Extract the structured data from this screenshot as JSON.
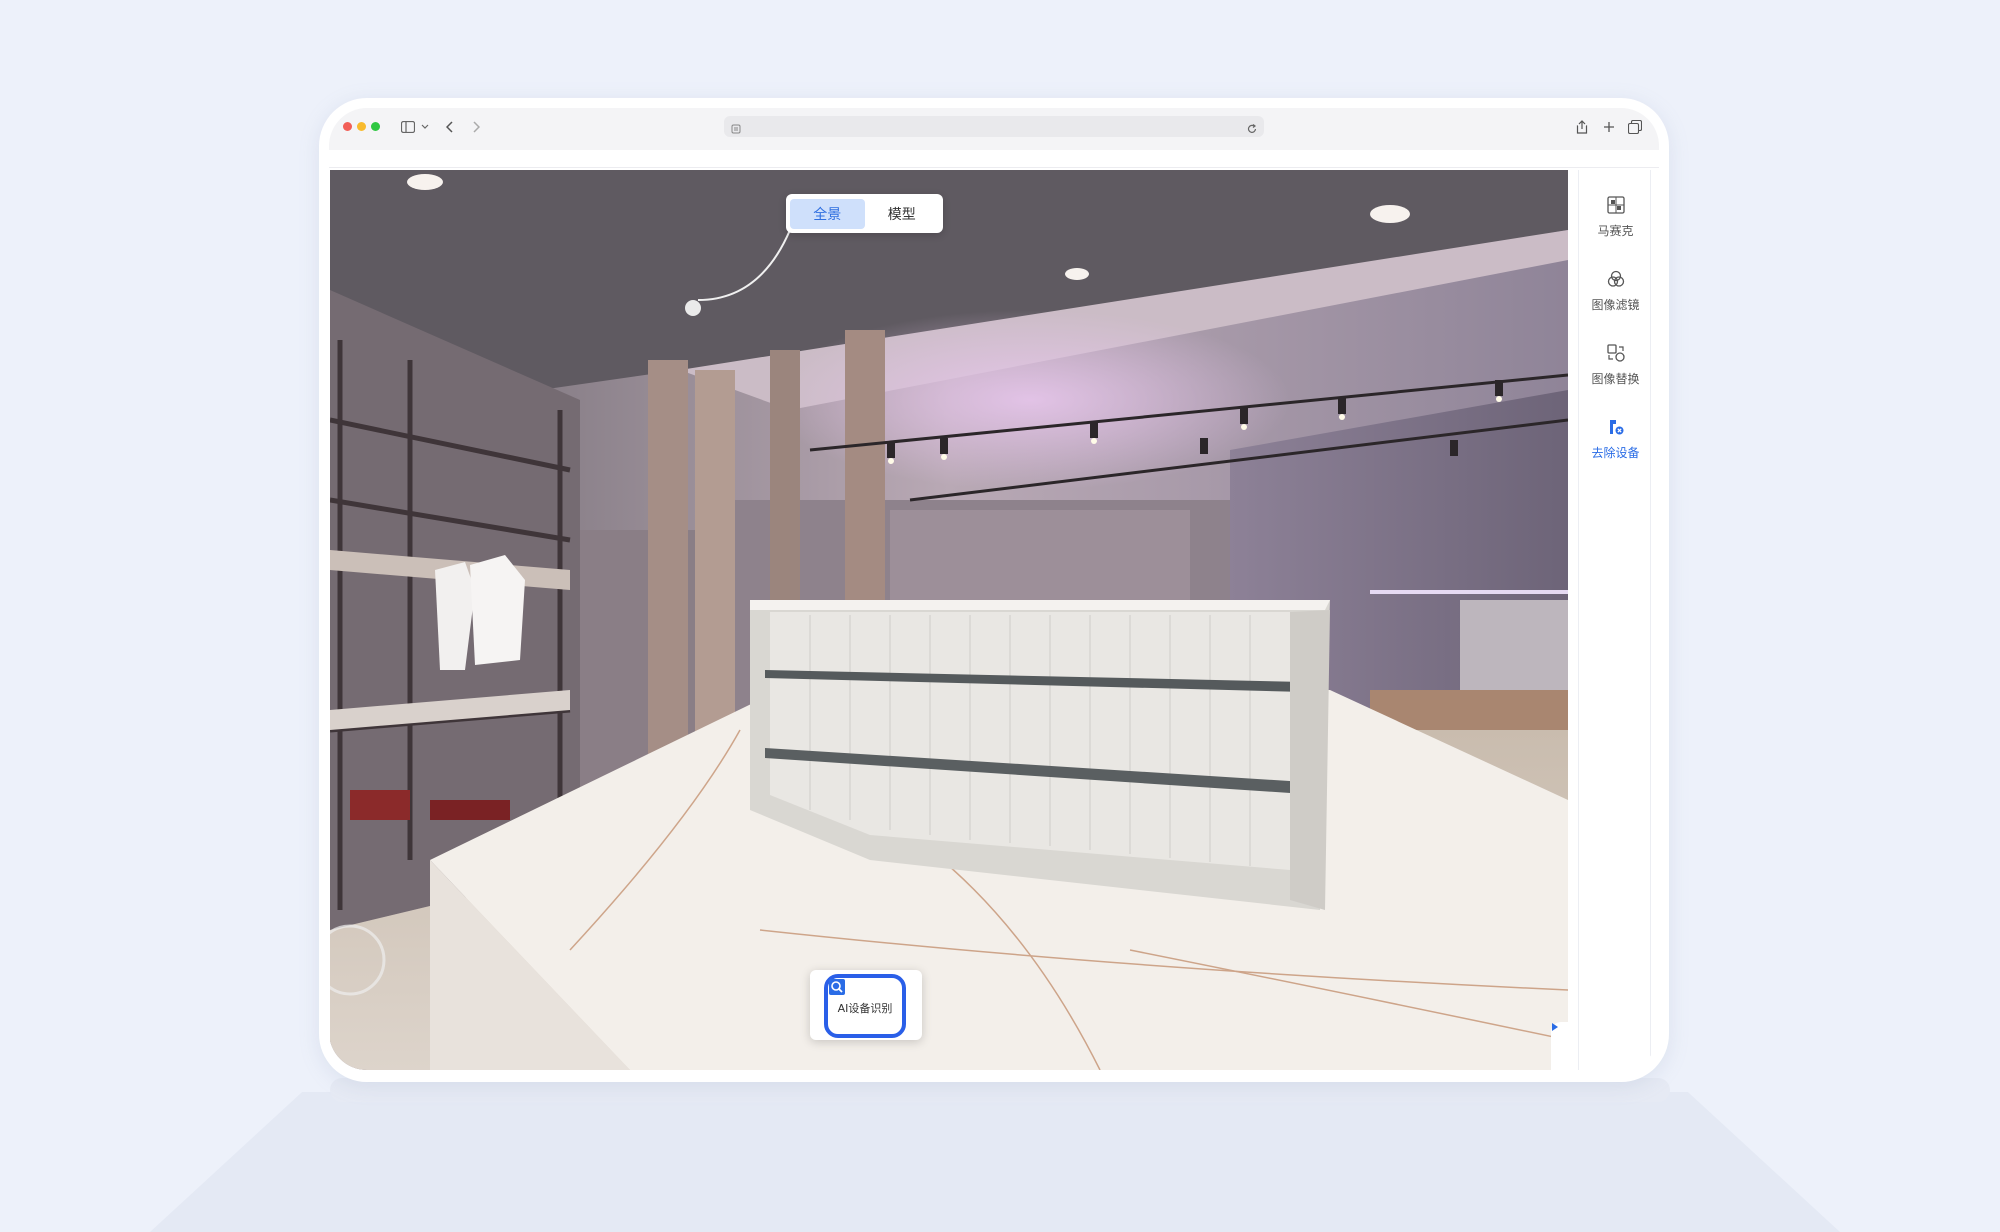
{
  "browser": {
    "url": ""
  },
  "view_toggle": {
    "options": [
      "全景",
      "模型"
    ],
    "selected": "全景"
  },
  "right_panel": {
    "items": [
      {
        "label": "马赛克",
        "icon": "mosaic-icon",
        "active": false
      },
      {
        "label": "图像滤镜",
        "icon": "filter-icon",
        "active": false
      },
      {
        "label": "图像替换",
        "icon": "image-replace-icon",
        "active": false
      },
      {
        "label": "去除设备",
        "icon": "remove-device-icon",
        "active": true
      }
    ]
  },
  "ai_button": {
    "label": "AI设备识别",
    "icon": "scan-search-icon"
  },
  "colors": {
    "accent": "#2a6ce6",
    "toggle_active_bg": "#cfe0fb",
    "page_bg": "#edf1fa"
  }
}
